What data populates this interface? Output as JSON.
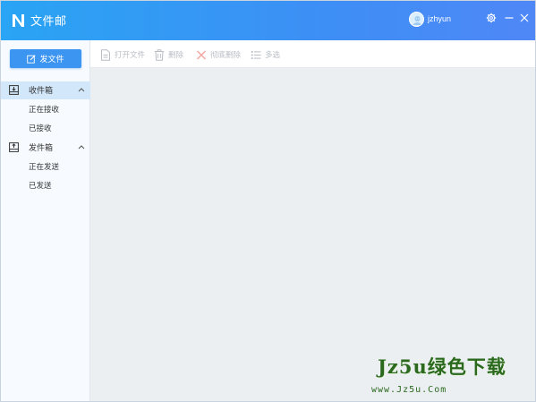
{
  "app": {
    "title": "文件邮"
  },
  "user": {
    "name": "jzhyun"
  },
  "titlebar_icons": [
    "n-logo-icon",
    "avatar-icon",
    "gear-icon",
    "minimize-icon",
    "close-icon"
  ],
  "sidebar": {
    "send_button": "发文件",
    "groups": [
      {
        "label": "收件箱",
        "active": true,
        "items": [
          "正在接收",
          "已接收"
        ]
      },
      {
        "label": "发件箱",
        "active": false,
        "items": [
          "正在发送",
          "已发送"
        ]
      }
    ]
  },
  "toolbar": {
    "open_file": "打开文件",
    "delete": "删除",
    "delete_forever": "彻底删除",
    "multi_select": "多选"
  },
  "watermark": {
    "main": "Jz5u绿色下载",
    "url": "www.Jz5u.Com"
  },
  "colors": {
    "titlebar_start": "#2aa4f4",
    "titlebar_end": "#4f87f6",
    "accent": "#3d95f2",
    "sidebar_bg": "#f7fbff",
    "active_item_bg": "#d3e7fb",
    "content_bg": "#ebeff2",
    "disabled_text": "#b8bec6",
    "watermark": "#2b6a1e"
  }
}
